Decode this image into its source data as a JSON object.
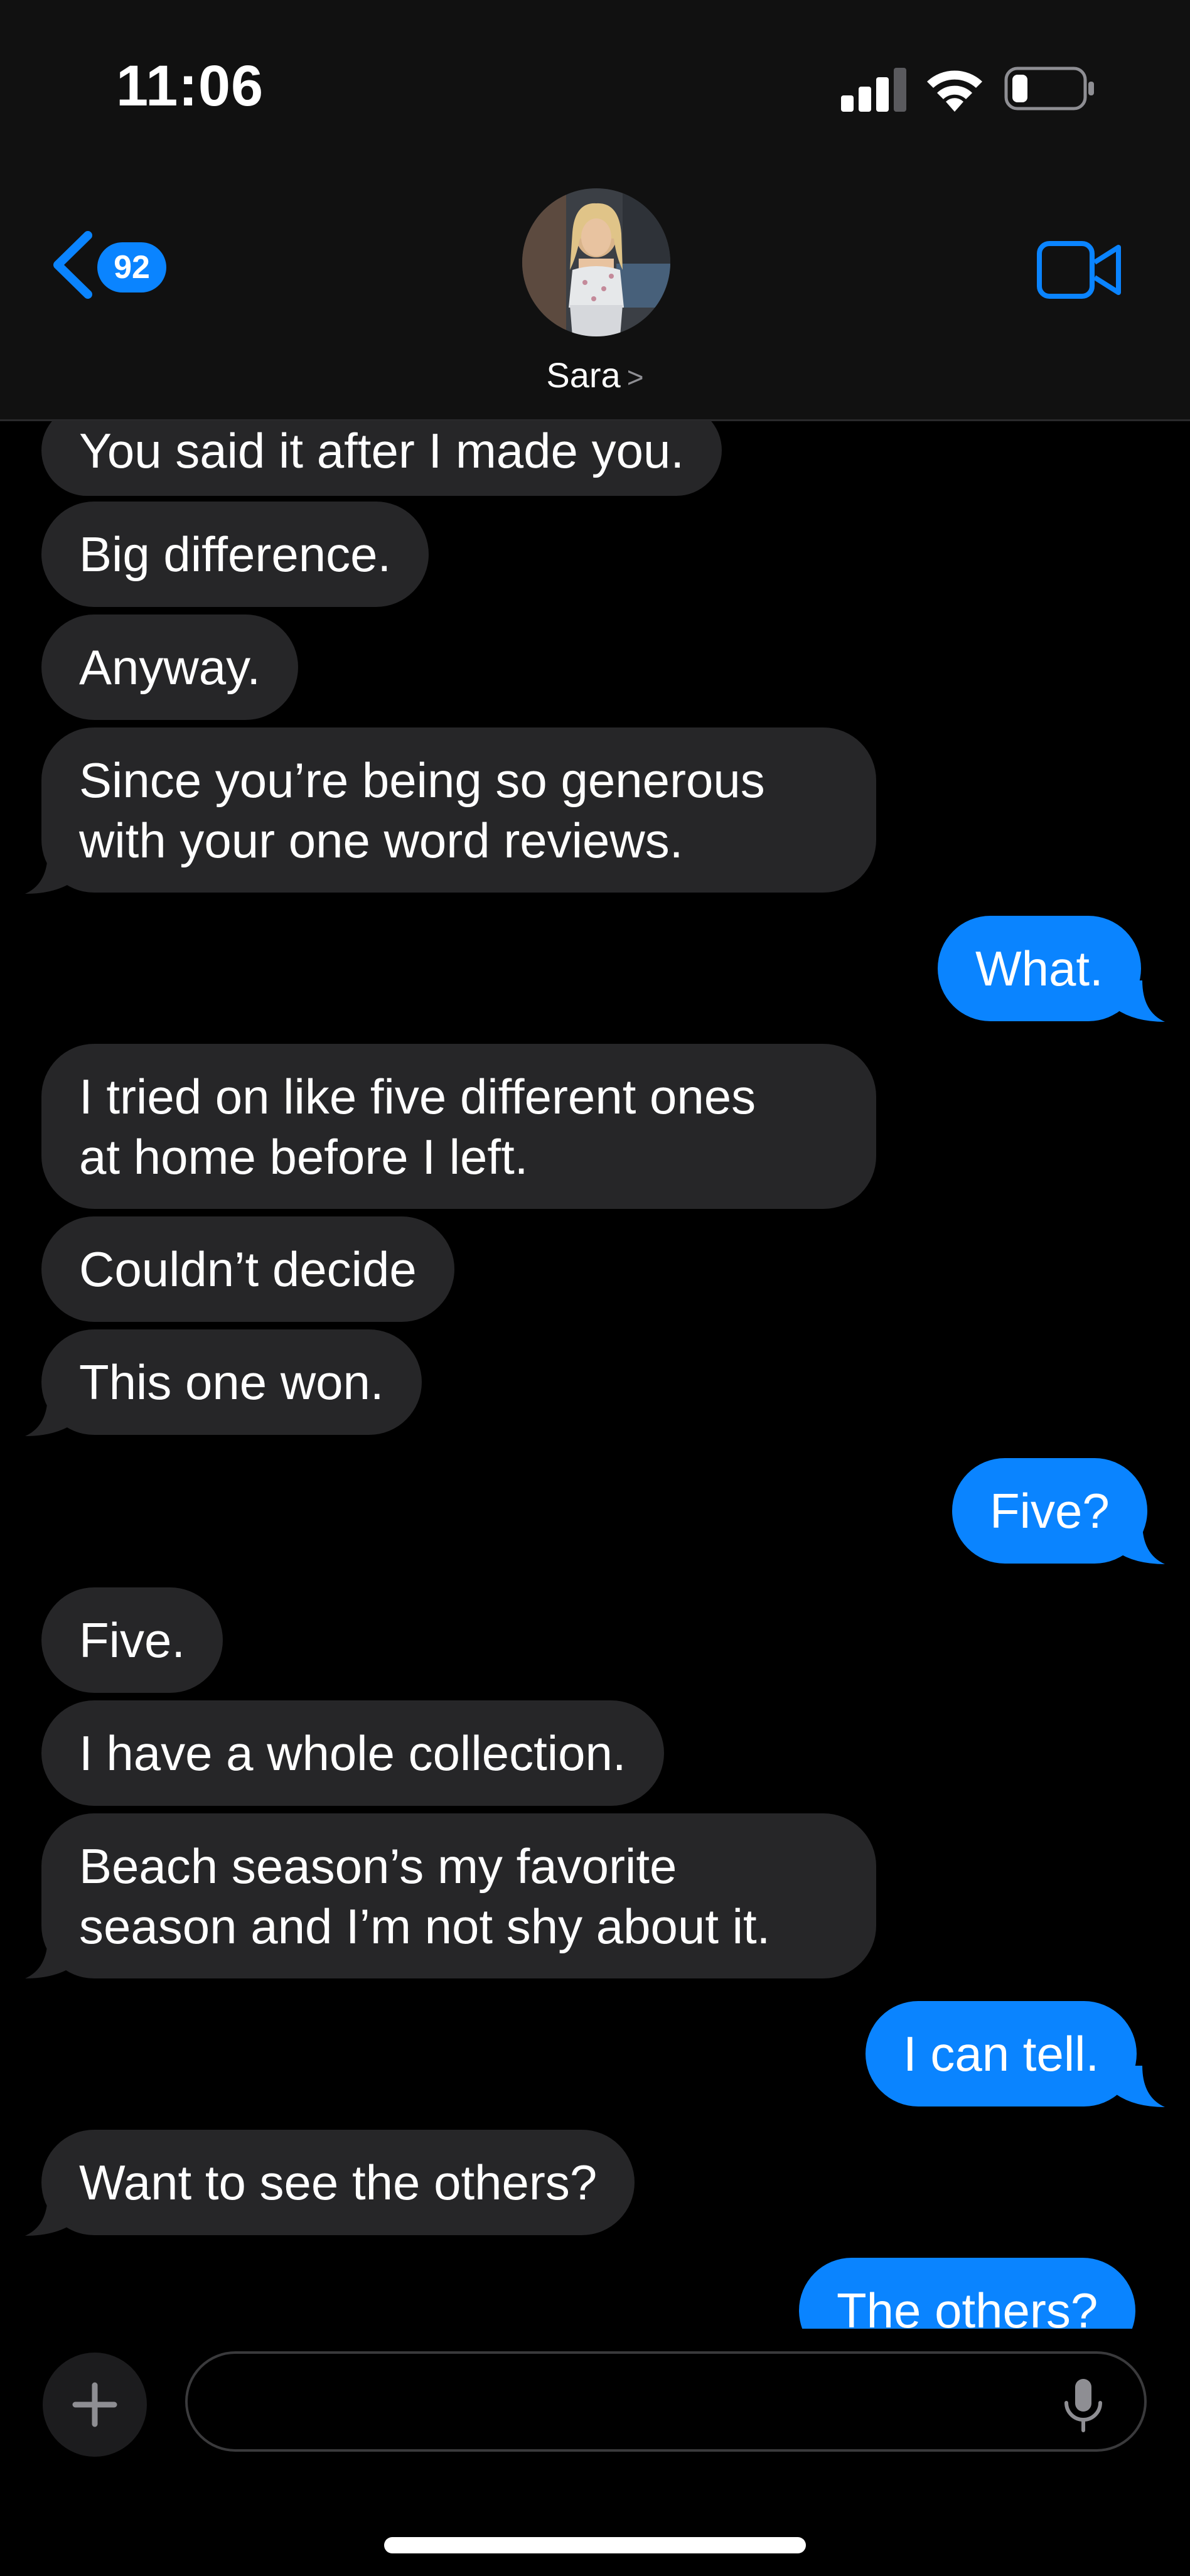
{
  "status_bar": {
    "time": "11:06"
  },
  "header": {
    "unread_count": "92",
    "contact_name": "Sara",
    "name_chevron": ">"
  },
  "colors": {
    "accent": "#0a84ff",
    "incoming_bubble": "#262628",
    "background": "#000000"
  },
  "messages": [
    {
      "direction": "incoming",
      "text": "You said it after I made you."
    },
    {
      "direction": "incoming",
      "text": "Big difference."
    },
    {
      "direction": "incoming",
      "text": "Anyway."
    },
    {
      "direction": "incoming",
      "lines": [
        "Since you’re being so generous",
        "with your one word reviews."
      ]
    },
    {
      "direction": "outgoing",
      "text": "What."
    },
    {
      "direction": "incoming",
      "lines": [
        "I tried on like five different ones",
        "at home before I left."
      ]
    },
    {
      "direction": "incoming",
      "text": "Couldn’t decide"
    },
    {
      "direction": "incoming",
      "text": "This one won."
    },
    {
      "direction": "outgoing",
      "text": "Five?"
    },
    {
      "direction": "incoming",
      "text": "Five."
    },
    {
      "direction": "incoming",
      "text": "I have a whole collection."
    },
    {
      "direction": "incoming",
      "lines": [
        "Beach season’s my favorite",
        "season and I’m not shy about it."
      ]
    },
    {
      "direction": "outgoing",
      "text": "I can tell."
    },
    {
      "direction": "incoming",
      "text": "Want to see the others?"
    },
    {
      "direction": "outgoing",
      "text": "The others?"
    }
  ],
  "compose": {
    "icons": [
      "plus-icon",
      "microphone-icon"
    ]
  }
}
